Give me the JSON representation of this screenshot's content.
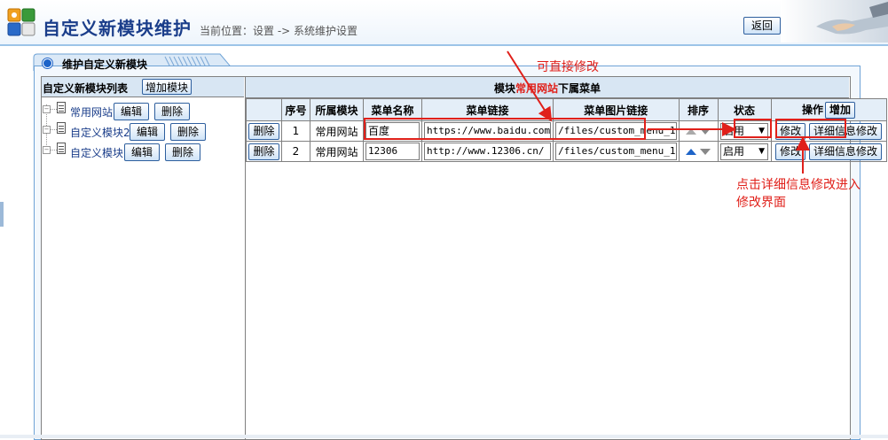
{
  "header": {
    "title": "自定义新模块维护",
    "breadcrumb": "当前位置：设置 -> 系统维护设置",
    "back_label": "返回"
  },
  "panel": {
    "tab_label": "维护自定义新模块"
  },
  "left": {
    "title": "自定义新模块列表",
    "add_module_label": "增加模块",
    "edit_label": "编辑",
    "delete_label": "删除",
    "modules": [
      {
        "name": "常用网站"
      },
      {
        "name": "自定义模块2"
      },
      {
        "name": "自定义模块"
      }
    ]
  },
  "right": {
    "title_prefix": "模块",
    "title_module": "常用网站",
    "title_suffix": "下属菜单",
    "columns": [
      "序号",
      "所属模块",
      "菜单名称",
      "菜单链接",
      "菜单图片链接",
      "排序",
      "状态",
      "操作"
    ],
    "add_label": "增加",
    "delete_label": "删除",
    "modify_label": "修改",
    "detail_label": "详细信息修改",
    "rows": [
      {
        "index": "1",
        "module": "常用网站",
        "name": "百度",
        "link": "https://www.baidu.com",
        "image": "/files/custom_menu_1",
        "status": "启用"
      },
      {
        "index": "2",
        "module": "常用网站",
        "name": "12306",
        "link": "http://www.12306.cn/",
        "image": "/files/custom_menu_1",
        "status": "启用"
      }
    ]
  },
  "annotations": {
    "direct_edit": "可直接修改",
    "detail_hint_line1": "点击详细信息修改进入",
    "detail_hint_line2": "修改界面",
    "color": "#e0201a"
  }
}
